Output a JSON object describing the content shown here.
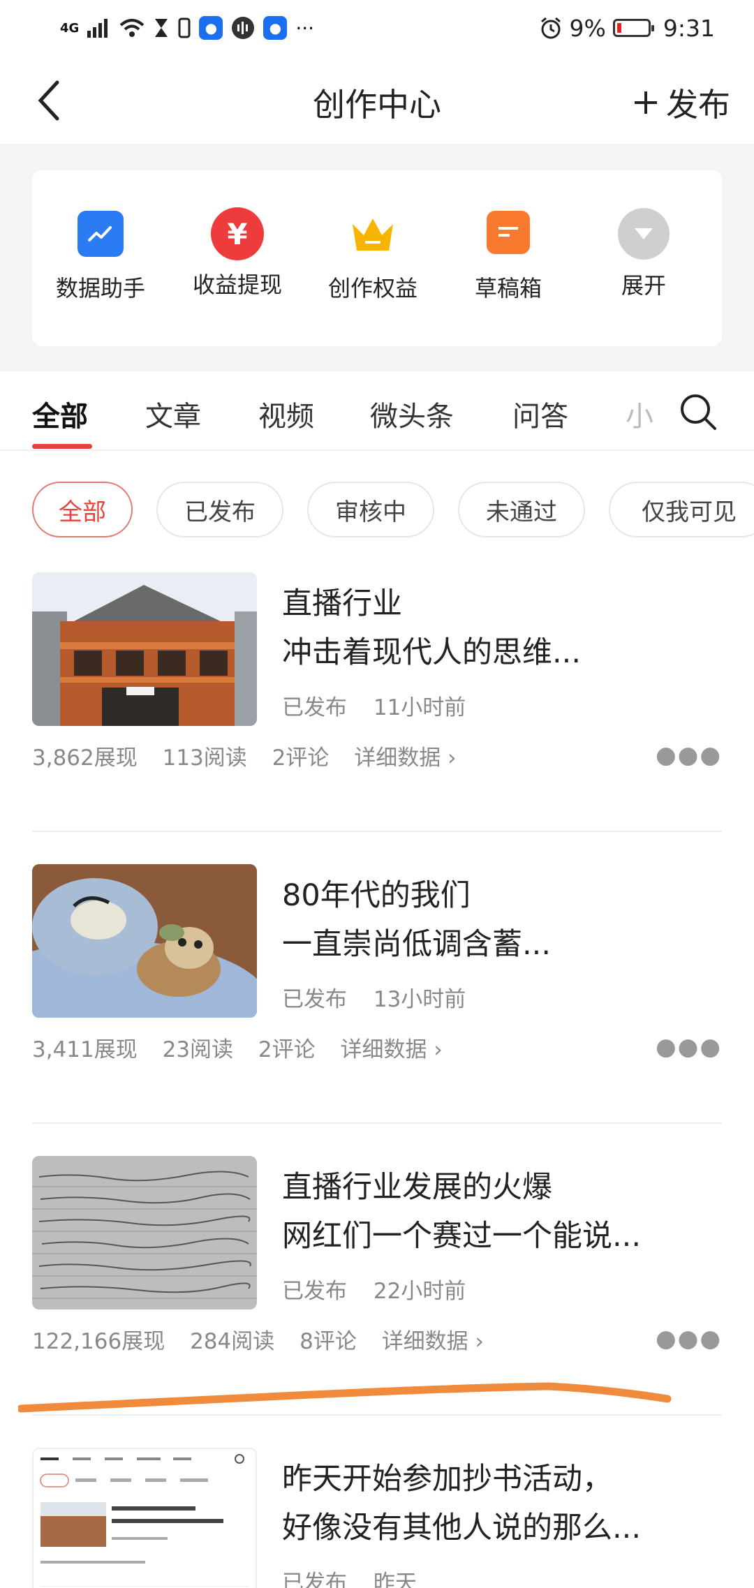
{
  "status_bar": {
    "network": "4G",
    "battery": "9%",
    "time": "9:31"
  },
  "header": {
    "title": "创作中心",
    "publish_label": "发布"
  },
  "tools": [
    {
      "label": "数据助手",
      "icon": "chart-icon",
      "color": "#2b7bf2"
    },
    {
      "label": "收益提现",
      "icon": "yuan-icon",
      "color": "#ee3b3b"
    },
    {
      "label": "创作权益",
      "icon": "crown-icon",
      "color": "#f7b500"
    },
    {
      "label": "草稿箱",
      "icon": "draft-icon",
      "color": "#f97a2e"
    },
    {
      "label": "展开",
      "icon": "expand-icon",
      "color": "#cfcfcf"
    }
  ],
  "tabs": [
    "全部",
    "文章",
    "视频",
    "微头条",
    "问答",
    "小"
  ],
  "filters": [
    "全部",
    "已发布",
    "审核中",
    "未通过",
    "仅我可见"
  ],
  "articles": [
    {
      "title_line1": "直播行业",
      "title_line2": "冲击着现代人的思维...",
      "status": "已发布",
      "time": "11小时前",
      "impressions": "3,862展现",
      "reads": "113阅读",
      "comments": "2评论",
      "details": "详细数据 ›"
    },
    {
      "title_line1": "80年代的我们",
      "title_line2": "一直崇尚低调含蓄...",
      "status": "已发布",
      "time": "13小时前",
      "impressions": "3,411展现",
      "reads": "23阅读",
      "comments": "2评论",
      "details": "详细数据 ›"
    },
    {
      "title_line1": "直播行业发展的火爆",
      "title_line2": "网红们一个赛过一个能说...",
      "status": "已发布",
      "time": "22小时前",
      "impressions": "122,166展现",
      "reads": "284阅读",
      "comments": "8评论",
      "details": "详细数据 ›"
    },
    {
      "title_line1": "昨天开始参加抄书活动，",
      "title_line2": "好像没有其他人说的那么...",
      "status": "已发布",
      "time": "昨天"
    }
  ],
  "colors": {
    "accent": "#e8413b",
    "annotation": "#f08a3c"
  }
}
